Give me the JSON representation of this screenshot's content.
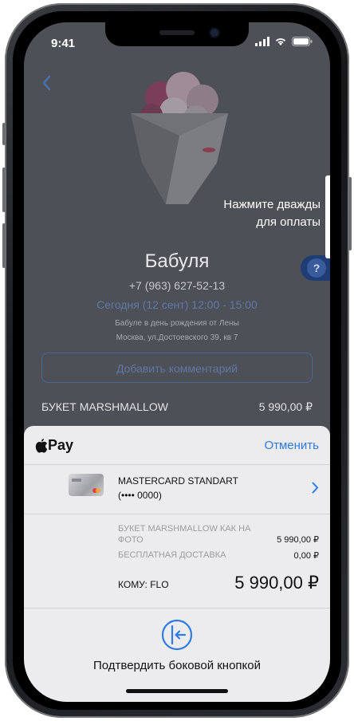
{
  "status_bar": {
    "time": "9:41"
  },
  "back_app": {
    "contact_name": "Бабуля",
    "contact_phone": "+7 (963) 627-52-13",
    "delivery_time": "Сегодня (12 сент) 12:00 - 15:00",
    "note_line1": "Бабуле в день рождения от Лены",
    "note_line2": "Москва, ул.Достоевского 39, кв 7",
    "add_comment_label": "Добавить комментарий",
    "order_item": "БУКЕТ MARSHMALLOW",
    "order_price": "5 990,00 ₽",
    "help_symbol": "?"
  },
  "side_hint": {
    "line1": "Нажмите дважды",
    "line2": "для оплаты"
  },
  "apple_pay": {
    "logo_text": "Pay",
    "cancel_label": "Отменить",
    "card_name": "MASTERCARD STANDART",
    "card_number": "(•••• 0000)",
    "item1_label": "БУКЕТ MARSHMALLOW КАК НА ФОТО",
    "item1_price": "5 990,00 ₽",
    "item2_label": "БЕСПЛАТНАЯ ДОСТАВКА",
    "item2_price": "0,00 ₽",
    "total_label": "КОМУ: FLO",
    "total_price": "5 990,00 ₽",
    "confirm_text": "Подтвердить боковой кнопкой"
  },
  "colors": {
    "accent_blue": "#2f7ae5",
    "sheet_bg": "#ececee",
    "dim_overlay": "#4d5057"
  }
}
